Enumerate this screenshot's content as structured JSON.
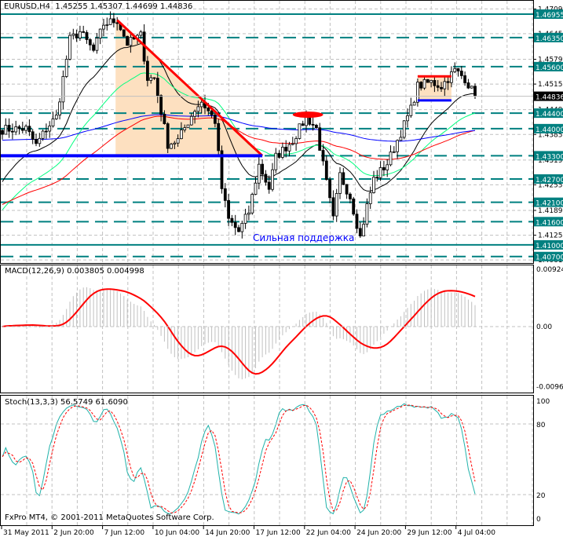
{
  "header": {
    "symbol": "EURUSD,H4",
    "ohlc": "1.45255 1.45307 1.44699 1.44836"
  },
  "annotation_text": "Сильная поддержка",
  "copyright": "FxPro MT4, © 2001-2011 MetaQuotes Software Corp.",
  "colors": {
    "level": "#008080",
    "trend": "#ff0000",
    "support": "#0000ff",
    "zone": "#fde0c0",
    "stoch_main": "#20b2aa",
    "stoch_signal": "#ff0000",
    "macd_hist": "#c0c0c0",
    "macd_signal": "#ff0000"
  },
  "chart_data": [
    {
      "type": "candlestick",
      "title": "EURUSD,H4",
      "price_ticks": [
        "1.47090",
        "1.46450",
        "1.45790",
        "1.45150",
        "1.44490",
        "1.43850",
        "1.43190",
        "1.42550",
        "1.41890",
        "1.41250",
        "1.40610"
      ],
      "ylim": [
        1.4055,
        1.4745
      ],
      "levels": [
        {
          "price": 1.46955,
          "label": "1.46955",
          "style": "solid"
        },
        {
          "price": 1.4635,
          "label": "1.46350",
          "style": "dashed"
        },
        {
          "price": 1.456,
          "label": "1.45600",
          "style": "dashed"
        },
        {
          "price": 1.444,
          "label": "1.44400",
          "style": "dashed"
        },
        {
          "price": 1.44,
          "label": "1.44000",
          "style": "dashed"
        },
        {
          "price": 1.433,
          "label": "1.43300",
          "style": "dashed"
        },
        {
          "price": 1.427,
          "label": "1.42700",
          "style": "dashed"
        },
        {
          "price": 1.421,
          "label": "1.42100",
          "style": "dashed"
        },
        {
          "price": 1.416,
          "label": "1.41600",
          "style": "dashed"
        },
        {
          "price": 1.41,
          "label": "1.41000",
          "style": "solid"
        },
        {
          "price": 1.407,
          "label": "1.40700",
          "style": "dashed"
        }
      ],
      "current_price": {
        "price": 1.44836,
        "label": "1.44836"
      },
      "close_waypoints": [
        [
          0,
          1.4398
        ],
        [
          7,
          1.44
        ],
        [
          10,
          1.4357
        ],
        [
          13,
          1.44
        ],
        [
          16,
          1.443
        ],
        [
          20,
          1.463
        ],
        [
          23,
          1.465
        ],
        [
          27,
          1.46
        ],
        [
          30,
          1.467
        ],
        [
          34,
          1.468
        ],
        [
          37,
          1.462
        ],
        [
          41,
          1.464
        ],
        [
          43,
          1.453
        ],
        [
          45,
          1.453
        ],
        [
          49,
          1.436
        ],
        [
          52,
          1.437
        ],
        [
          57,
          1.445
        ],
        [
          59,
          1.447
        ],
        [
          63,
          1.442
        ],
        [
          65,
          1.4246
        ],
        [
          67,
          1.4165
        ],
        [
          70,
          1.4134
        ],
        [
          73,
          1.4185
        ],
        [
          76,
          1.4306
        ],
        [
          79,
          1.4246
        ],
        [
          81,
          1.4327
        ],
        [
          86,
          1.437
        ],
        [
          90,
          1.443
        ],
        [
          93,
          1.44
        ],
        [
          95,
          1.4306
        ],
        [
          98,
          1.4165
        ],
        [
          100,
          1.428
        ],
        [
          103,
          1.4225
        ],
        [
          106,
          1.412
        ],
        [
          108,
          1.42
        ],
        [
          110,
          1.427
        ],
        [
          114,
          1.431
        ],
        [
          117,
          1.437
        ],
        [
          121,
          1.445
        ],
        [
          123,
          1.451
        ],
        [
          127,
          1.452
        ],
        [
          130,
          1.451
        ],
        [
          134,
          1.455
        ],
        [
          137,
          1.453
        ],
        [
          140,
          1.44836
        ]
      ],
      "trendline": {
        "from": [
          34,
          1.468
        ],
        "to": [
          77,
          1.433
        ]
      },
      "support_line": {
        "price": 1.433,
        "to_bar": 77
      },
      "resistance_marker": {
        "bar_from": 86,
        "bar_to": 95,
        "price": 1.4436
      },
      "range_box": {
        "bar_from": 123,
        "bar_to": 133,
        "top": 1.4535,
        "bottom": 1.4473
      },
      "xtick_labels": [
        "31 May 2011",
        "2 Jun 20:00",
        "7 Jun 12:00",
        "10 Jun 04:00",
        "14 Jun 20:00",
        "17 Jun 12:00",
        "22 Jun 04:00",
        "24 Jun 20:00",
        "29 Jun 12:00",
        "4 Jul 04:00"
      ]
    },
    {
      "type": "bar",
      "title": "MACD(12,26,9) 0.003805 0.004998",
      "params": [
        12,
        26,
        9
      ],
      "last_main": 0.003805,
      "last_signal": 0.004998,
      "ticks": [
        "0.009240",
        "0.00",
        "-0.009680"
      ],
      "ylim": [
        -0.00968,
        0.00924
      ]
    },
    {
      "type": "line",
      "title": "Stoch(13,3,3) 56.5749 61.6090",
      "params": [
        13,
        3,
        3
      ],
      "last_main": 56.5749,
      "last_signal": 61.609,
      "ticks": [
        "100",
        "80",
        "20",
        "0"
      ],
      "ylim": [
        0,
        100
      ]
    }
  ]
}
